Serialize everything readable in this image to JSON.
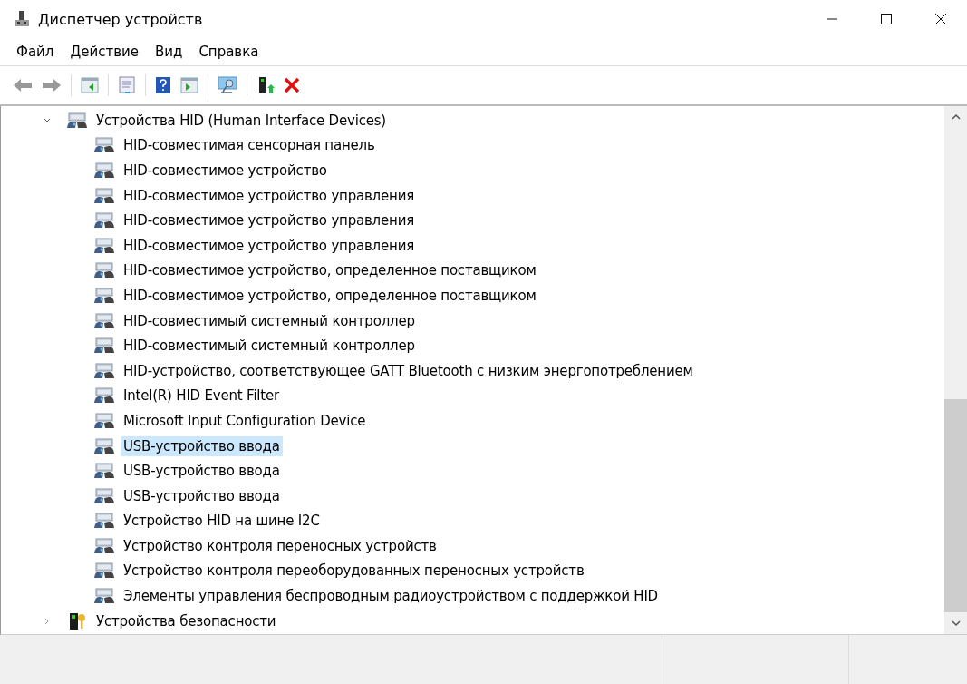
{
  "window": {
    "title": "Диспетчер устройств"
  },
  "menu": [
    "Файл",
    "Действие",
    "Вид",
    "Справка"
  ],
  "tree": [
    {
      "label": "Устройства HID (Human Interface Devices)",
      "kind": "hid",
      "expanded": true,
      "selected": false,
      "children": [
        {
          "label": "HID-совместимая сенсорная панель",
          "kind": "hid",
          "selected": false
        },
        {
          "label": "HID-совместимое устройство",
          "kind": "hid",
          "selected": false
        },
        {
          "label": "HID-совместимое устройство управления",
          "kind": "hid",
          "selected": false
        },
        {
          "label": "HID-совместимое устройство управления",
          "kind": "hid",
          "selected": false
        },
        {
          "label": "HID-совместимое устройство управления",
          "kind": "hid",
          "selected": false
        },
        {
          "label": "HID-совместимое устройство, определенное поставщиком",
          "kind": "hid",
          "selected": false
        },
        {
          "label": "HID-совместимое устройство, определенное поставщиком",
          "kind": "hid",
          "selected": false
        },
        {
          "label": "HID-совместимый системный контроллер",
          "kind": "hid",
          "selected": false
        },
        {
          "label": "HID-совместимый системный контроллер",
          "kind": "hid",
          "selected": false
        },
        {
          "label": "HID-устройство, соответствующее GATT Bluetooth с низким энергопотреблением",
          "kind": "hid",
          "selected": false
        },
        {
          "label": "Intel(R) HID Event Filter",
          "kind": "hid",
          "selected": false
        },
        {
          "label": "Microsoft Input Configuration Device",
          "kind": "hid",
          "selected": false
        },
        {
          "label": "USB-устройство ввода",
          "kind": "hid",
          "selected": true
        },
        {
          "label": "USB-устройство ввода",
          "kind": "hid",
          "selected": false
        },
        {
          "label": "USB-устройство ввода",
          "kind": "hid",
          "selected": false
        },
        {
          "label": "Устройство HID на шине I2C",
          "kind": "hid",
          "selected": false
        },
        {
          "label": "Устройство контроля переносных устройств",
          "kind": "hid",
          "selected": false
        },
        {
          "label": "Устройство контроля переоборудованных переносных устройств",
          "kind": "hid",
          "selected": false
        },
        {
          "label": "Элементы управления беспроводным радиоустройством с поддержкой HID",
          "kind": "hid",
          "selected": false
        }
      ]
    },
    {
      "label": "Устройства безопасности",
      "kind": "security",
      "expanded": false,
      "selected": false
    }
  ]
}
